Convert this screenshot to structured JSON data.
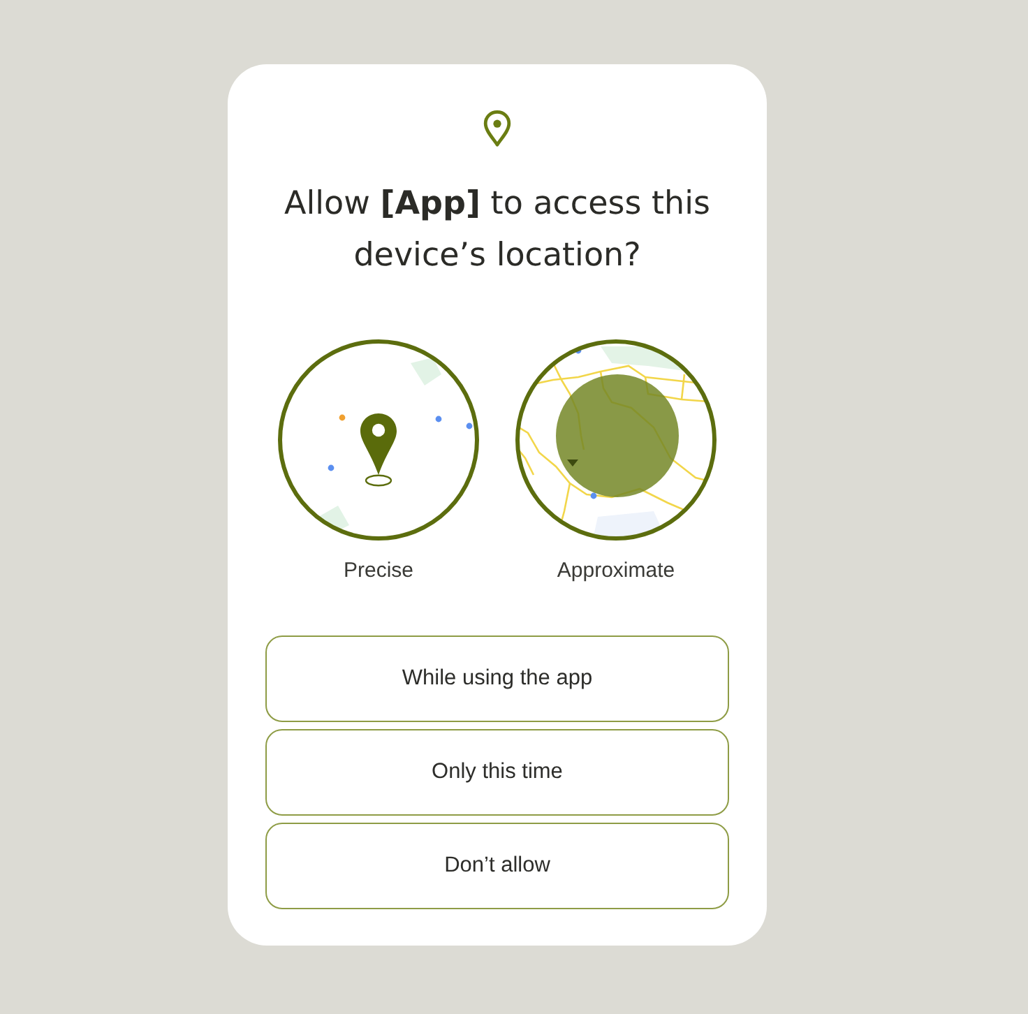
{
  "dialog": {
    "title": "Allow **[App]** to access this device’s location?"
  },
  "location_options": [
    {
      "kind": "precise",
      "label": "Precise"
    },
    {
      "kind": "approximate",
      "label": "Approximate"
    }
  ],
  "buttons": [
    "While using the app",
    "Only this time",
    "Don’t allow"
  ]
}
